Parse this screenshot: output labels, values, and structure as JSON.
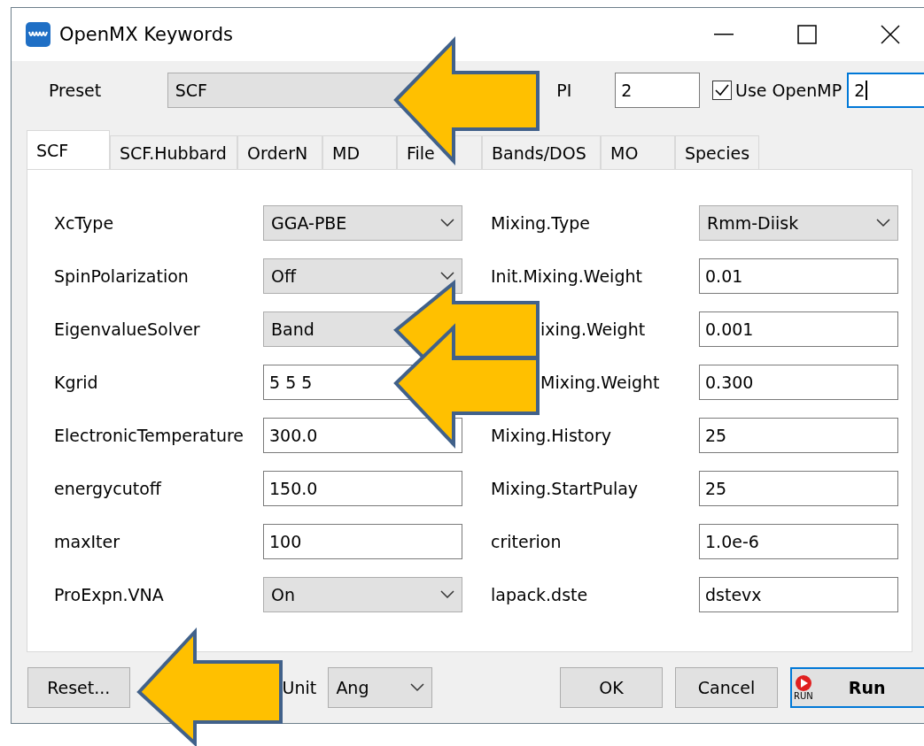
{
  "window": {
    "title": "OpenMX Keywords"
  },
  "preset": {
    "label": "Preset",
    "value": "SCF"
  },
  "mpi": {
    "label": "PI",
    "value": "2"
  },
  "openmp": {
    "label": "Use OpenMP",
    "checked": true,
    "value": "2",
    "focused": true
  },
  "tabs": [
    {
      "label": "SCF",
      "selected": true
    },
    {
      "label": "SCF.Hubbard",
      "selected": false
    },
    {
      "label": "OrderN",
      "selected": false
    },
    {
      "label": "MD",
      "selected": false
    },
    {
      "label": "File",
      "selected": false
    },
    {
      "label": "Bands/DOS",
      "selected": false
    },
    {
      "label": "MO",
      "selected": false
    },
    {
      "label": "Species",
      "selected": false
    }
  ],
  "left_fields": [
    {
      "label": "XcType",
      "kind": "dropdown",
      "value": "GGA-PBE"
    },
    {
      "label": "SpinPolarization",
      "kind": "dropdown",
      "value": "Off"
    },
    {
      "label": "EigenvalueSolver",
      "kind": "covered_dropdown",
      "value": "Band"
    },
    {
      "label": "Kgrid",
      "kind": "text",
      "value": "5 5 5"
    },
    {
      "label": "ElectronicTemperature",
      "kind": "text",
      "value": "300.0"
    },
    {
      "label": "energycutoff",
      "kind": "text",
      "value": "150.0"
    },
    {
      "label": "maxIter",
      "kind": "text",
      "value": "100"
    },
    {
      "label": "ProExpn.VNA",
      "kind": "dropdown",
      "value": "On"
    }
  ],
  "right_fields": [
    {
      "label": "Mixing.Type",
      "kind": "dropdown",
      "value": "Rmm-Diisk"
    },
    {
      "label": "Init.Mixing.Weight",
      "kind": "text",
      "value": "0.01"
    },
    {
      "label": "ixing.Weight",
      "kind": "text",
      "value": "0.001",
      "label_covered": true
    },
    {
      "label": "Mixing.Weight",
      "kind": "text",
      "value": "0.300",
      "label_covered": true
    },
    {
      "label": "Mixing.History",
      "kind": "text",
      "value": "25"
    },
    {
      "label": "Mixing.StartPulay",
      "kind": "text",
      "value": "25"
    },
    {
      "label": "criterion",
      "kind": "text",
      "value": "1.0e-6"
    },
    {
      "label": "lapack.dste",
      "kind": "text",
      "value": "dstevx"
    }
  ],
  "reset_button": "Reset...",
  "unit": {
    "label": "Unit",
    "value": "Ang"
  },
  "buttons": [
    "OK",
    "Cancel"
  ],
  "run_button": {
    "label": "Run",
    "icon_text": "RUN",
    "default": true
  }
}
